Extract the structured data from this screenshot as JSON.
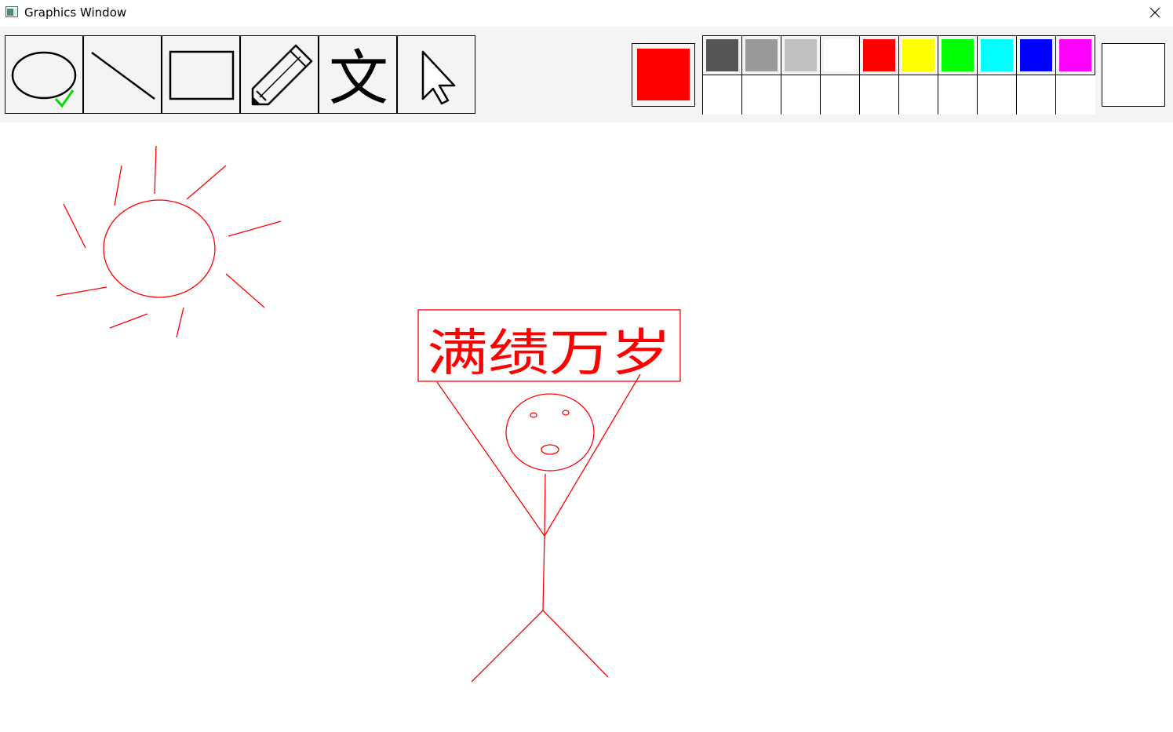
{
  "window": {
    "title": "Graphics Window"
  },
  "toolbar": {
    "tools": [
      {
        "name": "ellipse",
        "icon": "ellipse-icon",
        "selected": true
      },
      {
        "name": "line",
        "icon": "line-icon",
        "selected": false
      },
      {
        "name": "rectangle",
        "icon": "rectangle-icon",
        "selected": false
      },
      {
        "name": "pencil",
        "icon": "pencil-icon",
        "selected": false
      },
      {
        "name": "text",
        "icon": "text-icon",
        "glyph": "文",
        "selected": false
      },
      {
        "name": "select",
        "icon": "cursor-arrow-icon",
        "selected": false
      }
    ],
    "current_color": "#ff0000",
    "palette": [
      "#555555",
      "#999999",
      "#c0c0c0",
      "#ffffff",
      "#ff0000",
      "#ffff00",
      "#00ff00",
      "#00ffff",
      "#0000ff",
      "#ff00ff"
    ],
    "selected_check_color": "#00dd00"
  },
  "canvas": {
    "stroke_color": "#ff0000",
    "banner_text": "满绩万岁"
  }
}
